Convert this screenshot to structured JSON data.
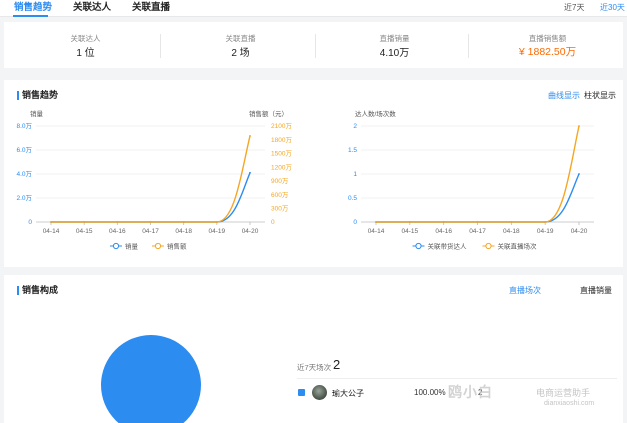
{
  "tabs": [
    {
      "label": "销售趋势"
    },
    {
      "label": "关联达人"
    },
    {
      "label": "关联直播"
    }
  ],
  "ranges": [
    "近7天",
    "近30天"
  ],
  "stats": [
    {
      "label": "关联达人",
      "value": "1 位"
    },
    {
      "label": "关联直播",
      "value": "2 场"
    },
    {
      "label": "直播销量",
      "value": "4.10万"
    },
    {
      "label": "直播销售额",
      "value": "¥ 1882.50万"
    }
  ],
  "trend": {
    "title": "销售趋势",
    "toggles": [
      "曲线显示",
      "柱状显示"
    ]
  },
  "composition": {
    "title": "销售构成",
    "toggles": [
      "直播场次",
      "直播销量"
    ],
    "summary_label": "近7天场次",
    "summary_value": "2",
    "row": {
      "name": "瑜大公子",
      "pct": "100.00%",
      "extra": "2"
    }
  },
  "watermark": {
    "brand": "鸥小白",
    "cn": "电商运营助手",
    "url": "dianxiaoshi.com"
  },
  "colors": {
    "accent": "#2d8cf0",
    "orange": "#f5a623",
    "highlight": "#ff6a00"
  },
  "chart_data": [
    {
      "type": "line",
      "x": [
        "04-14",
        "04-15",
        "04-16",
        "04-17",
        "04-18",
        "04-19",
        "04-20"
      ],
      "ylabel_left": "销量",
      "ylabel_right": "销售额（元）",
      "left_ticks": [
        "0",
        "2.0万",
        "4.0万",
        "6.0万",
        "8.0万"
      ],
      "right_ticks": [
        "0",
        "300万",
        "600万",
        "900万",
        "1200万",
        "1500万",
        "1800万",
        "2100万"
      ],
      "ylim_left": [
        0,
        80000
      ],
      "ylim_right": [
        0,
        21000000
      ],
      "series": [
        {
          "name": "销量",
          "axis": "left",
          "color": "#2d8cf0",
          "values": [
            0,
            0,
            0,
            0,
            0,
            0,
            41000
          ]
        },
        {
          "name": "销售额",
          "axis": "right",
          "color": "#f5a623",
          "values": [
            0,
            0,
            0,
            0,
            0,
            0,
            18825000
          ]
        }
      ],
      "legend": "bottom",
      "grid": true
    },
    {
      "type": "line",
      "x": [
        "04-14",
        "04-15",
        "04-16",
        "04-17",
        "04-18",
        "04-19",
        "04-20"
      ],
      "ylabel_left": "达人数/场次数",
      "left_ticks": [
        "0",
        "0.5",
        "1",
        "1.5",
        "2"
      ],
      "ylim_left": [
        0,
        2
      ],
      "series": [
        {
          "name": "关联带货达人",
          "axis": "left",
          "color": "#2d8cf0",
          "values": [
            0,
            0,
            0,
            0,
            0,
            0,
            1
          ]
        },
        {
          "name": "关联直播场次",
          "axis": "left",
          "color": "#f5a623",
          "values": [
            0,
            0,
            0,
            0,
            0,
            0,
            2
          ]
        }
      ],
      "legend": "bottom",
      "grid": true
    },
    {
      "type": "pie",
      "categories": [
        "瑜大公子"
      ],
      "values": [
        100
      ],
      "colors": [
        "#2d8cf0"
      ]
    }
  ]
}
